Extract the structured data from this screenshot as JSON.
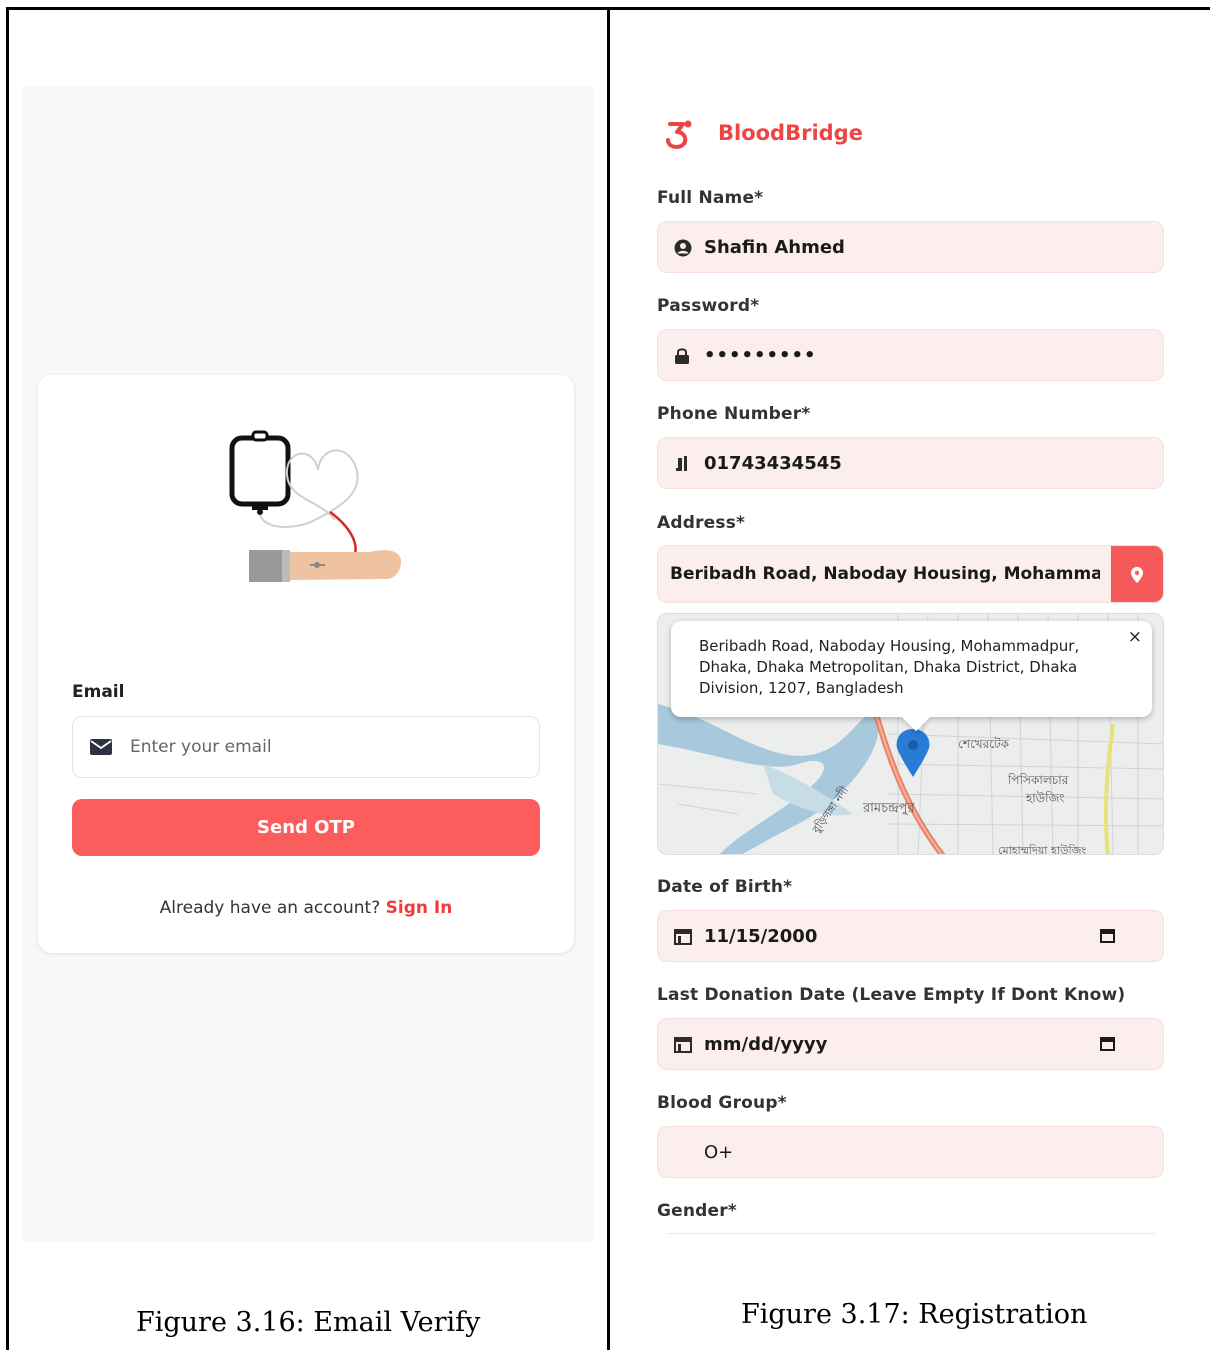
{
  "left_screen": {
    "email": {
      "label": "Email",
      "placeholder": "Enter your email",
      "icon": "envelope-icon"
    },
    "send_otp_label": "Send OTP",
    "signin_prompt": "Already have an account?",
    "signin_link": "Sign In",
    "caption": "Figure 3.16: Email Verify"
  },
  "right_screen": {
    "brand": {
      "name": "BloodBridge",
      "icon": "blood-drop-logo-icon",
      "color": "#ef4444"
    },
    "fields": {
      "full_name": {
        "label": "Full Name*",
        "value": "Shafin Ahmed",
        "icon": "user-circle-icon"
      },
      "password": {
        "label": "Password*",
        "value": "•••••••••",
        "icon": "lock-icon"
      },
      "phone": {
        "label": "Phone Number*",
        "value": "01743434545",
        "icon": "phone-icon"
      },
      "address": {
        "label": "Address*",
        "value": "Beribadh Road, Naboday Housing, Mohammadpur",
        "icon": "map-pin-icon"
      },
      "dob": {
        "label": "Date of Birth*",
        "value": "11/15/2000",
        "icon": "calendar-icon"
      },
      "last_donation": {
        "label": "Last Donation Date (Leave Empty If Dont Know)",
        "value": "mm/dd/yyyy",
        "icon": "calendar-icon"
      },
      "blood_group": {
        "label": "Blood Group*",
        "value": "O+"
      },
      "gender": {
        "label": "Gender*"
      }
    },
    "map": {
      "popup_text": "Beribadh Road, Naboday Housing, Mohammadpur, Dhaka, Dhaka Metropolitan, Dhaka District, Dhaka Division, 1207, Bangladesh",
      "close_label": "×",
      "place_labels": [
        "শেখেরটেক",
        "পিসিকালচার",
        "হাউজিং",
        "রামচন্দ্রপুর",
        "বুড়িগঙ্গা নদী",
        "মোহাম্মদিয়া হাউজিং"
      ]
    },
    "caption": "Figure 3.17: Registration"
  },
  "colors": {
    "accent": "#fb5d5d",
    "field_bg": "#fdeeee",
    "link": "#ef3b3b"
  }
}
